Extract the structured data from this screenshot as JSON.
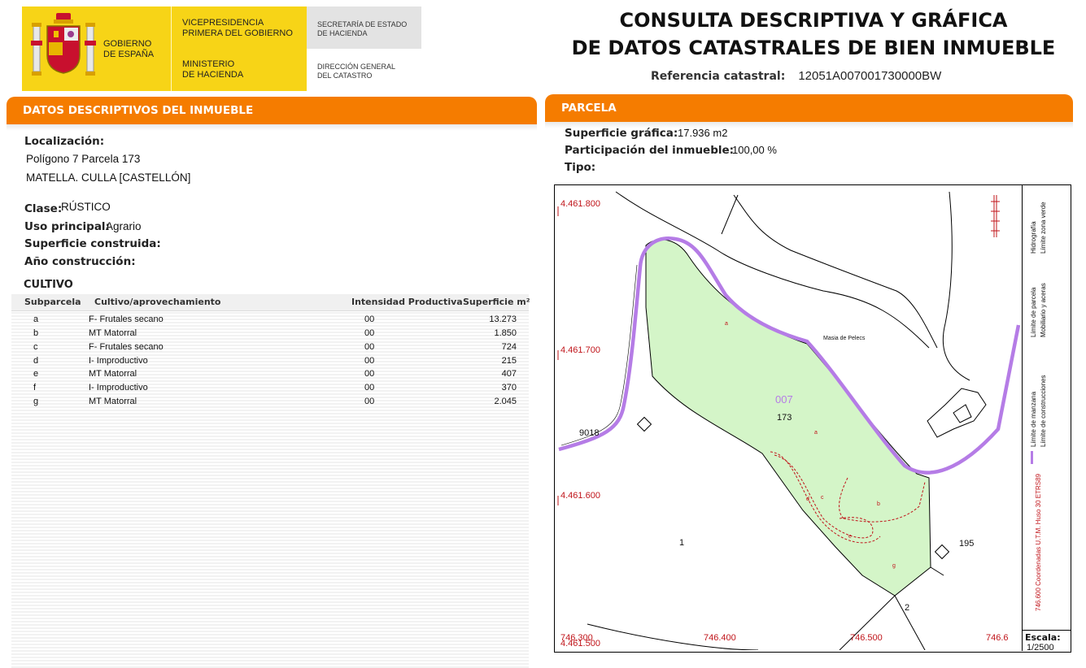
{
  "header": {
    "gov_line1": "GOBIERNO",
    "gov_line2": "DE ESPAÑA",
    "vice_line1": "VICEPRESIDENCIA",
    "vice_line2": "PRIMERA DEL GOBIERNO",
    "min_line1": "MINISTERIO",
    "min_line2": "DE HACIENDA",
    "sec_line1": "SECRETARÍA DE ESTADO",
    "sec_line2": "DE HACIENDA",
    "dir_line1": "DIRECCIÓN GENERAL",
    "dir_line2": "DEL CATASTRO",
    "title_line1": "CONSULTA DESCRIPTIVA Y GRÁFICA",
    "title_line2": "DE DATOS CATASTRALES DE BIEN INMUEBLE",
    "ref_label": "Referencia catastral:",
    "ref_value": "12051A007001730000BW"
  },
  "descriptive": {
    "section_title": "DATOS DESCRIPTIVOS DEL INMUEBLE",
    "loc_label": "Localización:",
    "loc_line1": "Polígono 7 Parcela 173",
    "loc_line2": "MATELLA. CULLA [CASTELLÓN]",
    "clase_label": "Clase:",
    "clase_value": "RÚSTICO",
    "uso_label": "Uso principal:",
    "uso_value": "Agrario",
    "sup_label": "Superficie construida:",
    "anio_label": "Año construcción:"
  },
  "cultivo": {
    "title": "CULTIVO",
    "headers": [
      "Subparcela",
      "Cultivo/aprovechamiento",
      "Intensidad Productiva",
      "Superficie m²"
    ],
    "rows": [
      {
        "sub": "a",
        "cultivo": "F- Frutales secano",
        "int": "00",
        "sup": "13.273"
      },
      {
        "sub": "b",
        "cultivo": "MT Matorral",
        "int": "00",
        "sup": "1.850"
      },
      {
        "sub": "c",
        "cultivo": "F- Frutales secano",
        "int": "00",
        "sup": "724"
      },
      {
        "sub": "d",
        "cultivo": "I- Improductivo",
        "int": "00",
        "sup": "215"
      },
      {
        "sub": "e",
        "cultivo": "MT Matorral",
        "int": "00",
        "sup": "407"
      },
      {
        "sub": "f",
        "cultivo": "I- Improductivo",
        "int": "00",
        "sup": "370"
      },
      {
        "sub": "g",
        "cultivo": "MT Matorral",
        "int": "00",
        "sup": "2.045"
      }
    ]
  },
  "parcela": {
    "section_title": "PARCELA",
    "sup_label": "Superficie gráfica:",
    "sup_value": "17.936 m2",
    "part_label": "Participación del inmueble:",
    "part_value": "100,00 %",
    "tipo_label": "Tipo:"
  },
  "map": {
    "y_ticks": [
      "4.461.800",
      "4.461.700",
      "4.461.600",
      "4.461.500"
    ],
    "x_ticks": [
      "746.300",
      "746.400",
      "746.500",
      "746.6"
    ],
    "labels": {
      "poligono": "007",
      "parcela": "173",
      "masia": "Masia de Pelecs",
      "road": "9018",
      "p1": "1",
      "p195": "195",
      "p2": "2",
      "sub_a": "a",
      "sub_b": "b",
      "sub_c": "c",
      "sub_d": "d",
      "sub_e": "e",
      "sub_g": "g"
    },
    "legend": {
      "manzana": "Límite de manzana",
      "parcela": "Límite de parcela",
      "hidrografia": "Hidrografía",
      "construcciones": "Límite de construcciones",
      "mobiliario": "Mobiliario y aceras",
      "zona_verde": "Límite zona verde",
      "coords": "746.600 Coordenadas U.T.M. Huso 30 ETRS89"
    },
    "scale_label": "Escala:",
    "scale_value": "1/2500",
    "colors": {
      "parcel_fill": "#d4f5c8",
      "manzana": "#b57ce6",
      "red": "#c0141a"
    }
  }
}
